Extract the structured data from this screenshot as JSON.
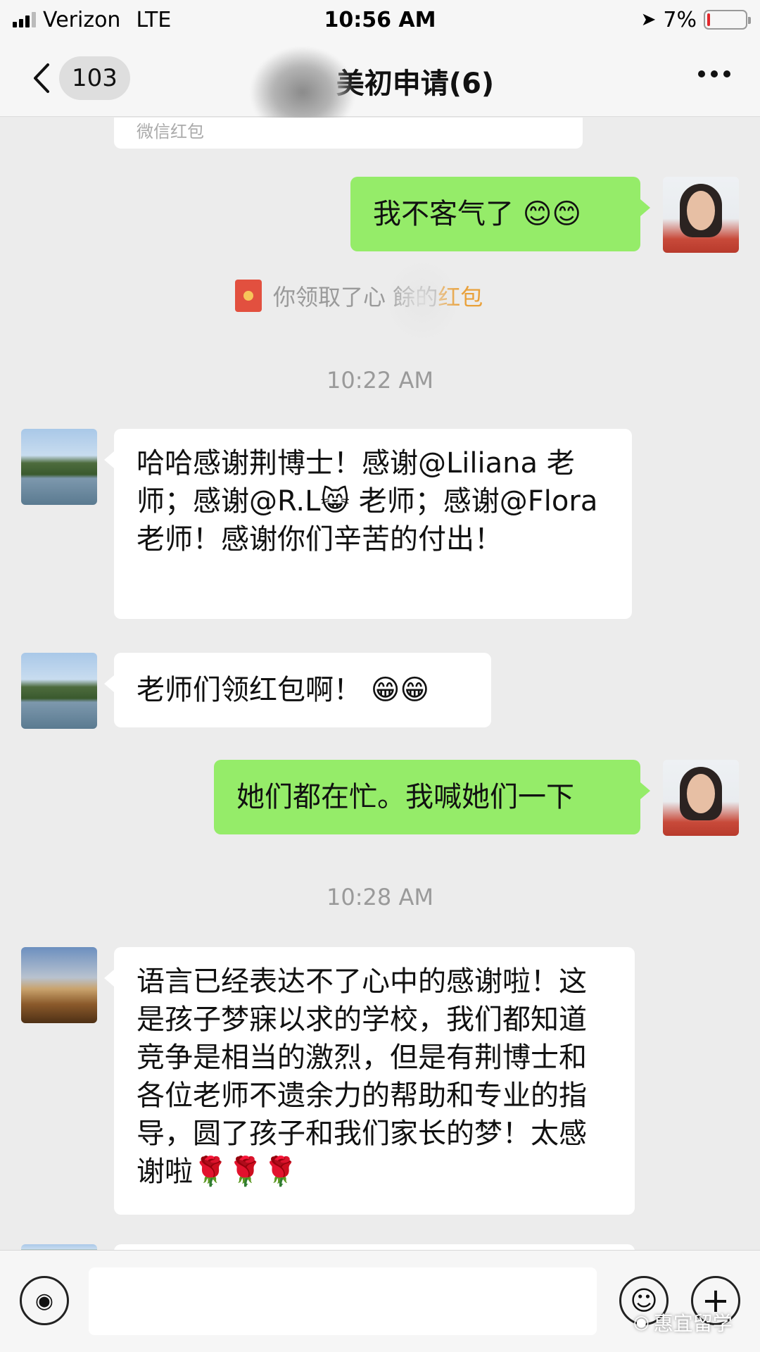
{
  "status_bar": {
    "carrier": "Verizon",
    "network": "LTE",
    "time": "10:56 AM",
    "battery": "7%",
    "battery_level": 0.07,
    "battery_color": "#e2262b"
  },
  "nav": {
    "unread_count": "103",
    "title": "美初申请(6)",
    "back_icon": "chevron-left-icon",
    "more_icon": "more-dots-icon"
  },
  "chat": {
    "partial_card_text": "微信红包",
    "messages": [
      {
        "side": "out",
        "text": "我不客气了 😊😊"
      },
      {
        "type": "note",
        "prefix": "你领取了",
        "name": "心 餘的",
        "link": "红包"
      },
      {
        "type": "time",
        "text": "10:22 AM"
      },
      {
        "side": "in",
        "text": "哈哈感谢荆博士！感谢@Liliana 老师；感谢@R.L😸 老师；感谢@Flora 老师！感谢你们辛苦的付出！"
      },
      {
        "side": "in",
        "text": "老师们领红包啊！ 😁😁"
      },
      {
        "side": "out",
        "text": "她们都在忙。我喊她们一下"
      },
      {
        "type": "time",
        "text": "10:28 AM"
      },
      {
        "side": "in",
        "text": "语言已经表达不了心中的感谢啦！这是孩子梦寐以求的学校，我们都知道竞争是相当的激烈，但是有荆博士和各位老师不遗余力的帮助和专业的指导，圆了孩子和我们家长的梦！太感谢啦🌹🌹🌹"
      }
    ]
  },
  "input_bar": {
    "placeholder": "",
    "voice_icon": "voice-icon",
    "emoji_icon": "emoji-icon",
    "plus_icon": "plus-icon"
  },
  "watermark": {
    "text": "惠宜留学"
  },
  "colors": {
    "outgoing_bubble": "#95ec69",
    "incoming_bubble": "#ffffff",
    "background": "#ececec",
    "link": "#e9a13b"
  }
}
